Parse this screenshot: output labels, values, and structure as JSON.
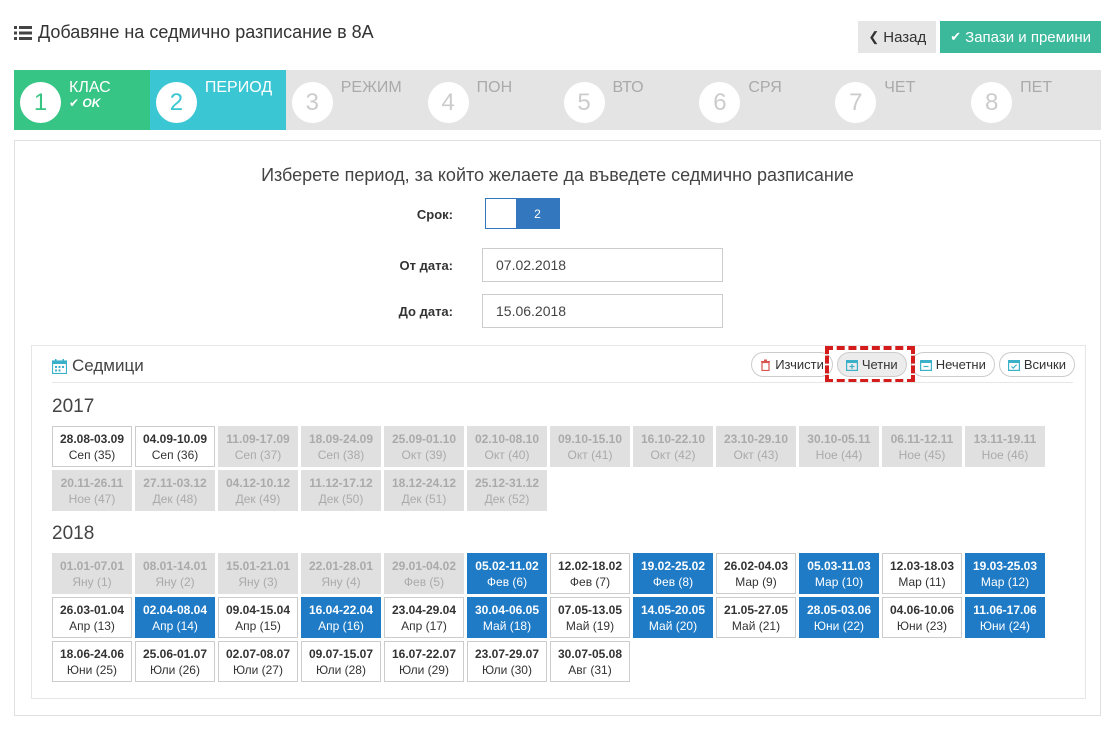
{
  "header": {
    "title": "Добавяне на седмично разписание в 8А",
    "back_label": "Назад",
    "save_label": "Запази и премини"
  },
  "wizard": [
    {
      "num": "1",
      "label": "КЛАС",
      "sub": "OK",
      "state": "done"
    },
    {
      "num": "2",
      "label": "ПЕРИОД",
      "sub": "",
      "state": "active"
    },
    {
      "num": "3",
      "label": "РЕЖИМ",
      "sub": "",
      "state": "todo"
    },
    {
      "num": "4",
      "label": "ПОН",
      "sub": "",
      "state": "todo"
    },
    {
      "num": "5",
      "label": "ВТО",
      "sub": "",
      "state": "todo"
    },
    {
      "num": "6",
      "label": "СРЯ",
      "sub": "",
      "state": "todo"
    },
    {
      "num": "7",
      "label": "ЧЕТ",
      "sub": "",
      "state": "todo"
    },
    {
      "num": "8",
      "label": "ПЕТ",
      "sub": "",
      "state": "todo"
    }
  ],
  "form": {
    "instruction": "Изберете период, за който желаете да въведете седмично разписание",
    "term_label": "Срок:",
    "term_value": "2",
    "from_label": "От дата:",
    "from_value": "07.02.2018",
    "to_label": "До дата:",
    "to_value": "15.06.2018"
  },
  "weeks": {
    "title": "Седмици",
    "buttons": {
      "clear": "Изчисти",
      "even": "Четни",
      "odd": "Нечетни",
      "all": "Всички"
    },
    "years": [
      {
        "year": "2017",
        "items": [
          {
            "d": "28.08-03.09",
            "m": "Сеп (35)",
            "s": "open"
          },
          {
            "d": "04.09-10.09",
            "m": "Сеп (36)",
            "s": "open"
          },
          {
            "d": "11.09-17.09",
            "m": "Сеп (37)",
            "s": "past"
          },
          {
            "d": "18.09-24.09",
            "m": "Сеп (38)",
            "s": "past"
          },
          {
            "d": "25.09-01.10",
            "m": "Окт (39)",
            "s": "past"
          },
          {
            "d": "02.10-08.10",
            "m": "Окт (40)",
            "s": "past"
          },
          {
            "d": "09.10-15.10",
            "m": "Окт (41)",
            "s": "past"
          },
          {
            "d": "16.10-22.10",
            "m": "Окт (42)",
            "s": "past"
          },
          {
            "d": "23.10-29.10",
            "m": "Окт (43)",
            "s": "past"
          },
          {
            "d": "30.10-05.11",
            "m": "Ное (44)",
            "s": "past"
          },
          {
            "d": "06.11-12.11",
            "m": "Ное (45)",
            "s": "past"
          },
          {
            "d": "13.11-19.11",
            "m": "Ное (46)",
            "s": "past"
          },
          {
            "d": "20.11-26.11",
            "m": "Ное (47)",
            "s": "past"
          },
          {
            "d": "27.11-03.12",
            "m": "Дек (48)",
            "s": "past"
          },
          {
            "d": "04.12-10.12",
            "m": "Дек (49)",
            "s": "past"
          },
          {
            "d": "11.12-17.12",
            "m": "Дек (50)",
            "s": "past"
          },
          {
            "d": "18.12-24.12",
            "m": "Дек (51)",
            "s": "past"
          },
          {
            "d": "25.12-31.12",
            "m": "Дек (52)",
            "s": "past"
          }
        ]
      },
      {
        "year": "2018",
        "items": [
          {
            "d": "01.01-07.01",
            "m": "Яну (1)",
            "s": "past"
          },
          {
            "d": "08.01-14.01",
            "m": "Яну (2)",
            "s": "past"
          },
          {
            "d": "15.01-21.01",
            "m": "Яну (3)",
            "s": "past"
          },
          {
            "d": "22.01-28.01",
            "m": "Яну (4)",
            "s": "past"
          },
          {
            "d": "29.01-04.02",
            "m": "Фев (5)",
            "s": "past"
          },
          {
            "d": "05.02-11.02",
            "m": "Фев (6)",
            "s": "sel"
          },
          {
            "d": "12.02-18.02",
            "m": "Фев (7)",
            "s": "open"
          },
          {
            "d": "19.02-25.02",
            "m": "Фев (8)",
            "s": "sel"
          },
          {
            "d": "26.02-04.03",
            "m": "Мар (9)",
            "s": "open"
          },
          {
            "d": "05.03-11.03",
            "m": "Мар (10)",
            "s": "sel"
          },
          {
            "d": "12.03-18.03",
            "m": "Мар (11)",
            "s": "open"
          },
          {
            "d": "19.03-25.03",
            "m": "Мар (12)",
            "s": "sel"
          },
          {
            "d": "26.03-01.04",
            "m": "Апр (13)",
            "s": "open"
          },
          {
            "d": "02.04-08.04",
            "m": "Апр (14)",
            "s": "sel"
          },
          {
            "d": "09.04-15.04",
            "m": "Апр (15)",
            "s": "open"
          },
          {
            "d": "16.04-22.04",
            "m": "Апр (16)",
            "s": "sel"
          },
          {
            "d": "23.04-29.04",
            "m": "Апр (17)",
            "s": "open"
          },
          {
            "d": "30.04-06.05",
            "m": "Май (18)",
            "s": "sel"
          },
          {
            "d": "07.05-13.05",
            "m": "Май (19)",
            "s": "open"
          },
          {
            "d": "14.05-20.05",
            "m": "Май (20)",
            "s": "sel"
          },
          {
            "d": "21.05-27.05",
            "m": "Май (21)",
            "s": "open"
          },
          {
            "d": "28.05-03.06",
            "m": "Юни (22)",
            "s": "sel"
          },
          {
            "d": "04.06-10.06",
            "m": "Юни (23)",
            "s": "open"
          },
          {
            "d": "11.06-17.06",
            "m": "Юни (24)",
            "s": "sel"
          },
          {
            "d": "18.06-24.06",
            "m": "Юни (25)",
            "s": "open"
          },
          {
            "d": "25.06-01.07",
            "m": "Юли (26)",
            "s": "open"
          },
          {
            "d": "02.07-08.07",
            "m": "Юли (27)",
            "s": "open"
          },
          {
            "d": "09.07-15.07",
            "m": "Юли (28)",
            "s": "open"
          },
          {
            "d": "16.07-22.07",
            "m": "Юли (29)",
            "s": "open"
          },
          {
            "d": "23.07-29.07",
            "m": "Юли (30)",
            "s": "open"
          },
          {
            "d": "30.07-05.08",
            "m": "Авг (31)",
            "s": "open"
          }
        ]
      }
    ]
  },
  "colors": {
    "done": "#36c585",
    "active": "#3bc6d3",
    "selected_week": "#1f7bc6",
    "save_button": "#3cb89a",
    "highlight": "#d41c1c"
  }
}
